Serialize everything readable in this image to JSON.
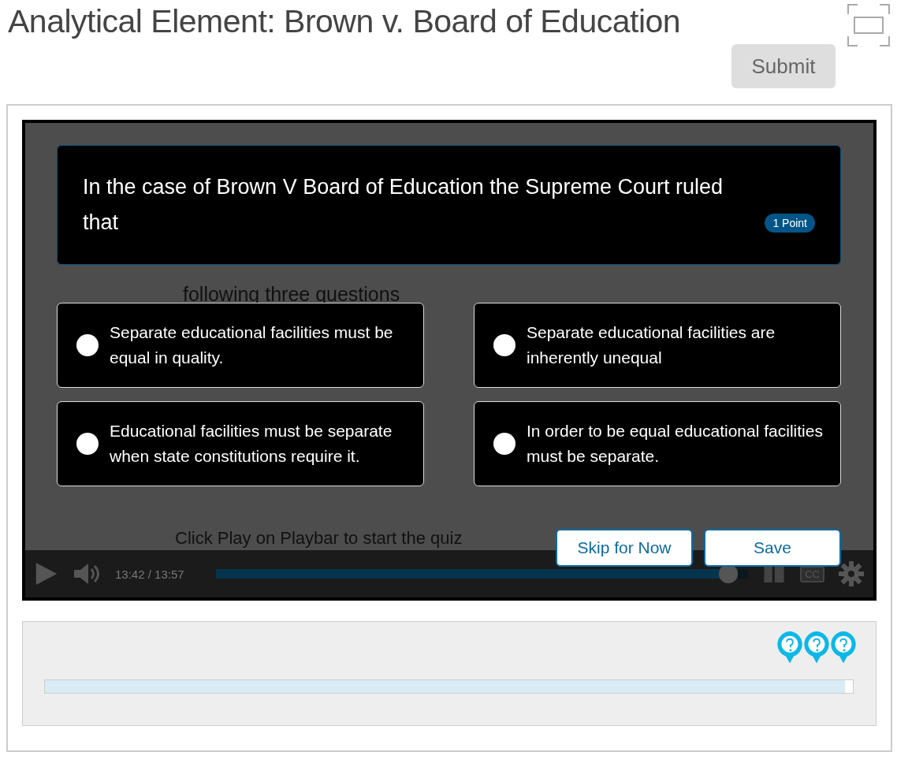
{
  "title": "Analytical Element: Brown v. Board of Education",
  "submit": {
    "label": "Submit",
    "disabled": true
  },
  "slide": {
    "lines": [
      "following three questions"
    ],
    "footer": "Click Play on Playbar to start the quiz"
  },
  "question": {
    "text": "In the case of Brown V Board of Education the Supreme Court ruled that",
    "points": "1 Point"
  },
  "options": [
    {
      "label": "Separate educational facilities must be equal in quality.",
      "selected": false
    },
    {
      "label": "Separate educational facilities are inherently unequal",
      "selected": false
    },
    {
      "label": "Educational facilities must be separate when state constitutions require it.",
      "selected": false
    },
    {
      "label": "In order to be equal educational facilities must be separate.",
      "selected": false
    }
  ],
  "actions": [
    "Skip for Now",
    "Save"
  ],
  "playbar": {
    "time": "13:42 / 13:57",
    "level": 0.98,
    "captions": "CC"
  },
  "timeline": {
    "level": 0.99,
    "markers": [
      {
        "kind": "question"
      },
      {
        "kind": "question"
      },
      {
        "kind": "question"
      }
    ]
  }
}
